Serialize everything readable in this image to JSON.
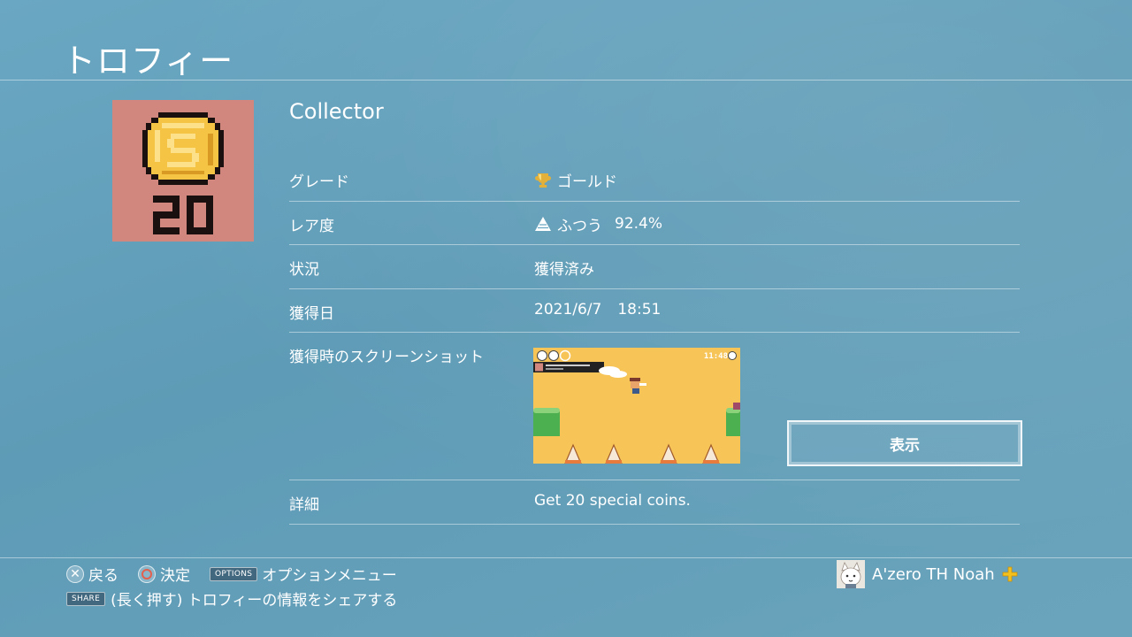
{
  "page": {
    "title": "トロフィー"
  },
  "trophy": {
    "name": "Collector",
    "icon_text": "20",
    "rows": [
      {
        "label": "グレード",
        "value": "ゴールド",
        "icon": "gold-trophy-icon"
      },
      {
        "label": "レア度",
        "value": "ふつう",
        "percent": "92.4%",
        "icon": "rarity-pyramid-icon"
      },
      {
        "label": "状況",
        "value": "獲得済み"
      },
      {
        "label": "獲得日",
        "date": "2021/6/7",
        "time": "18:51"
      },
      {
        "label": "獲得時のスクリーンショット"
      },
      {
        "label": "詳細",
        "value": "Get 20 special coins."
      }
    ],
    "view_button": "表示",
    "screenshot_clock": "11:48"
  },
  "footer": {
    "back": "戻る",
    "decide": "決定",
    "options_badge": "OPTIONS",
    "options_menu": "オプションメニュー",
    "share_badge": "SHARE",
    "share_hint": "(長く押す) トロフィーの情報をシェアする"
  },
  "user": {
    "name": "A'zero TH Noah"
  },
  "colors": {
    "background": "#6aa7c2",
    "icon_bg": "#d2877e",
    "coin": "#f5c445",
    "plus": "#f3c11e"
  }
}
